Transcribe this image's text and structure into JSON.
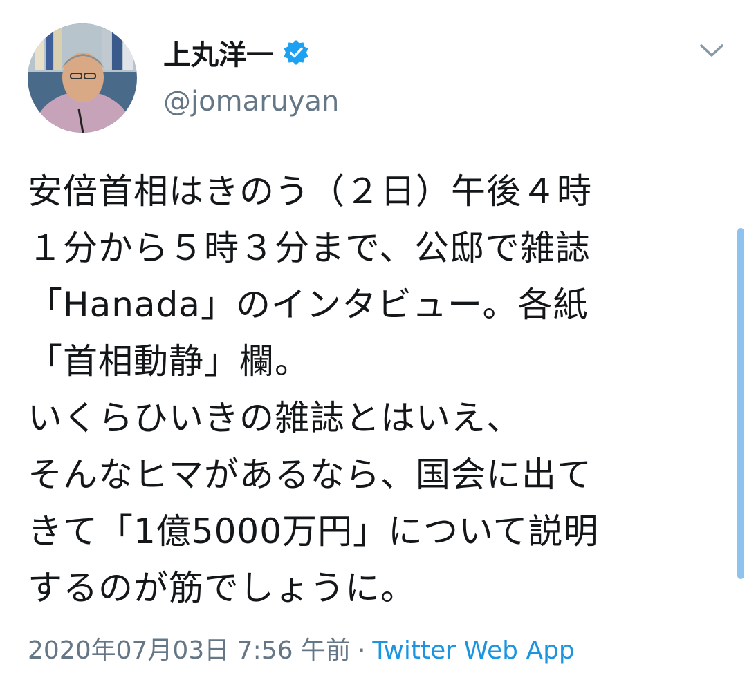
{
  "author": {
    "display_name": "上丸洋一",
    "handle": "@jomaruyan",
    "verified": true,
    "verified_icon": "verified-badge-icon",
    "avatar": "avatar-photo"
  },
  "tweet": {
    "text": "安倍首相はきのう（２日）午後４時\n１分から５時３分まで、公邸で雑誌\n「Hanada」のインタビュー。各紙\n「首相動静」欄。\nいくらひいきの雑誌とはいえ、\nそんなヒマがあるなら、国会に出て\nきて「1億5000万円」について説明\nするのが筋でしょうに。",
    "timestamp": "2020年07月03日 7:56 午前",
    "separator": "·",
    "source": "Twitter Web App"
  },
  "colors": {
    "text_primary": "#14171a",
    "text_secondary": "#657786",
    "link": "#1b95e0",
    "verified": "#1da1f2",
    "scrollbar": "#8fc3ef"
  }
}
